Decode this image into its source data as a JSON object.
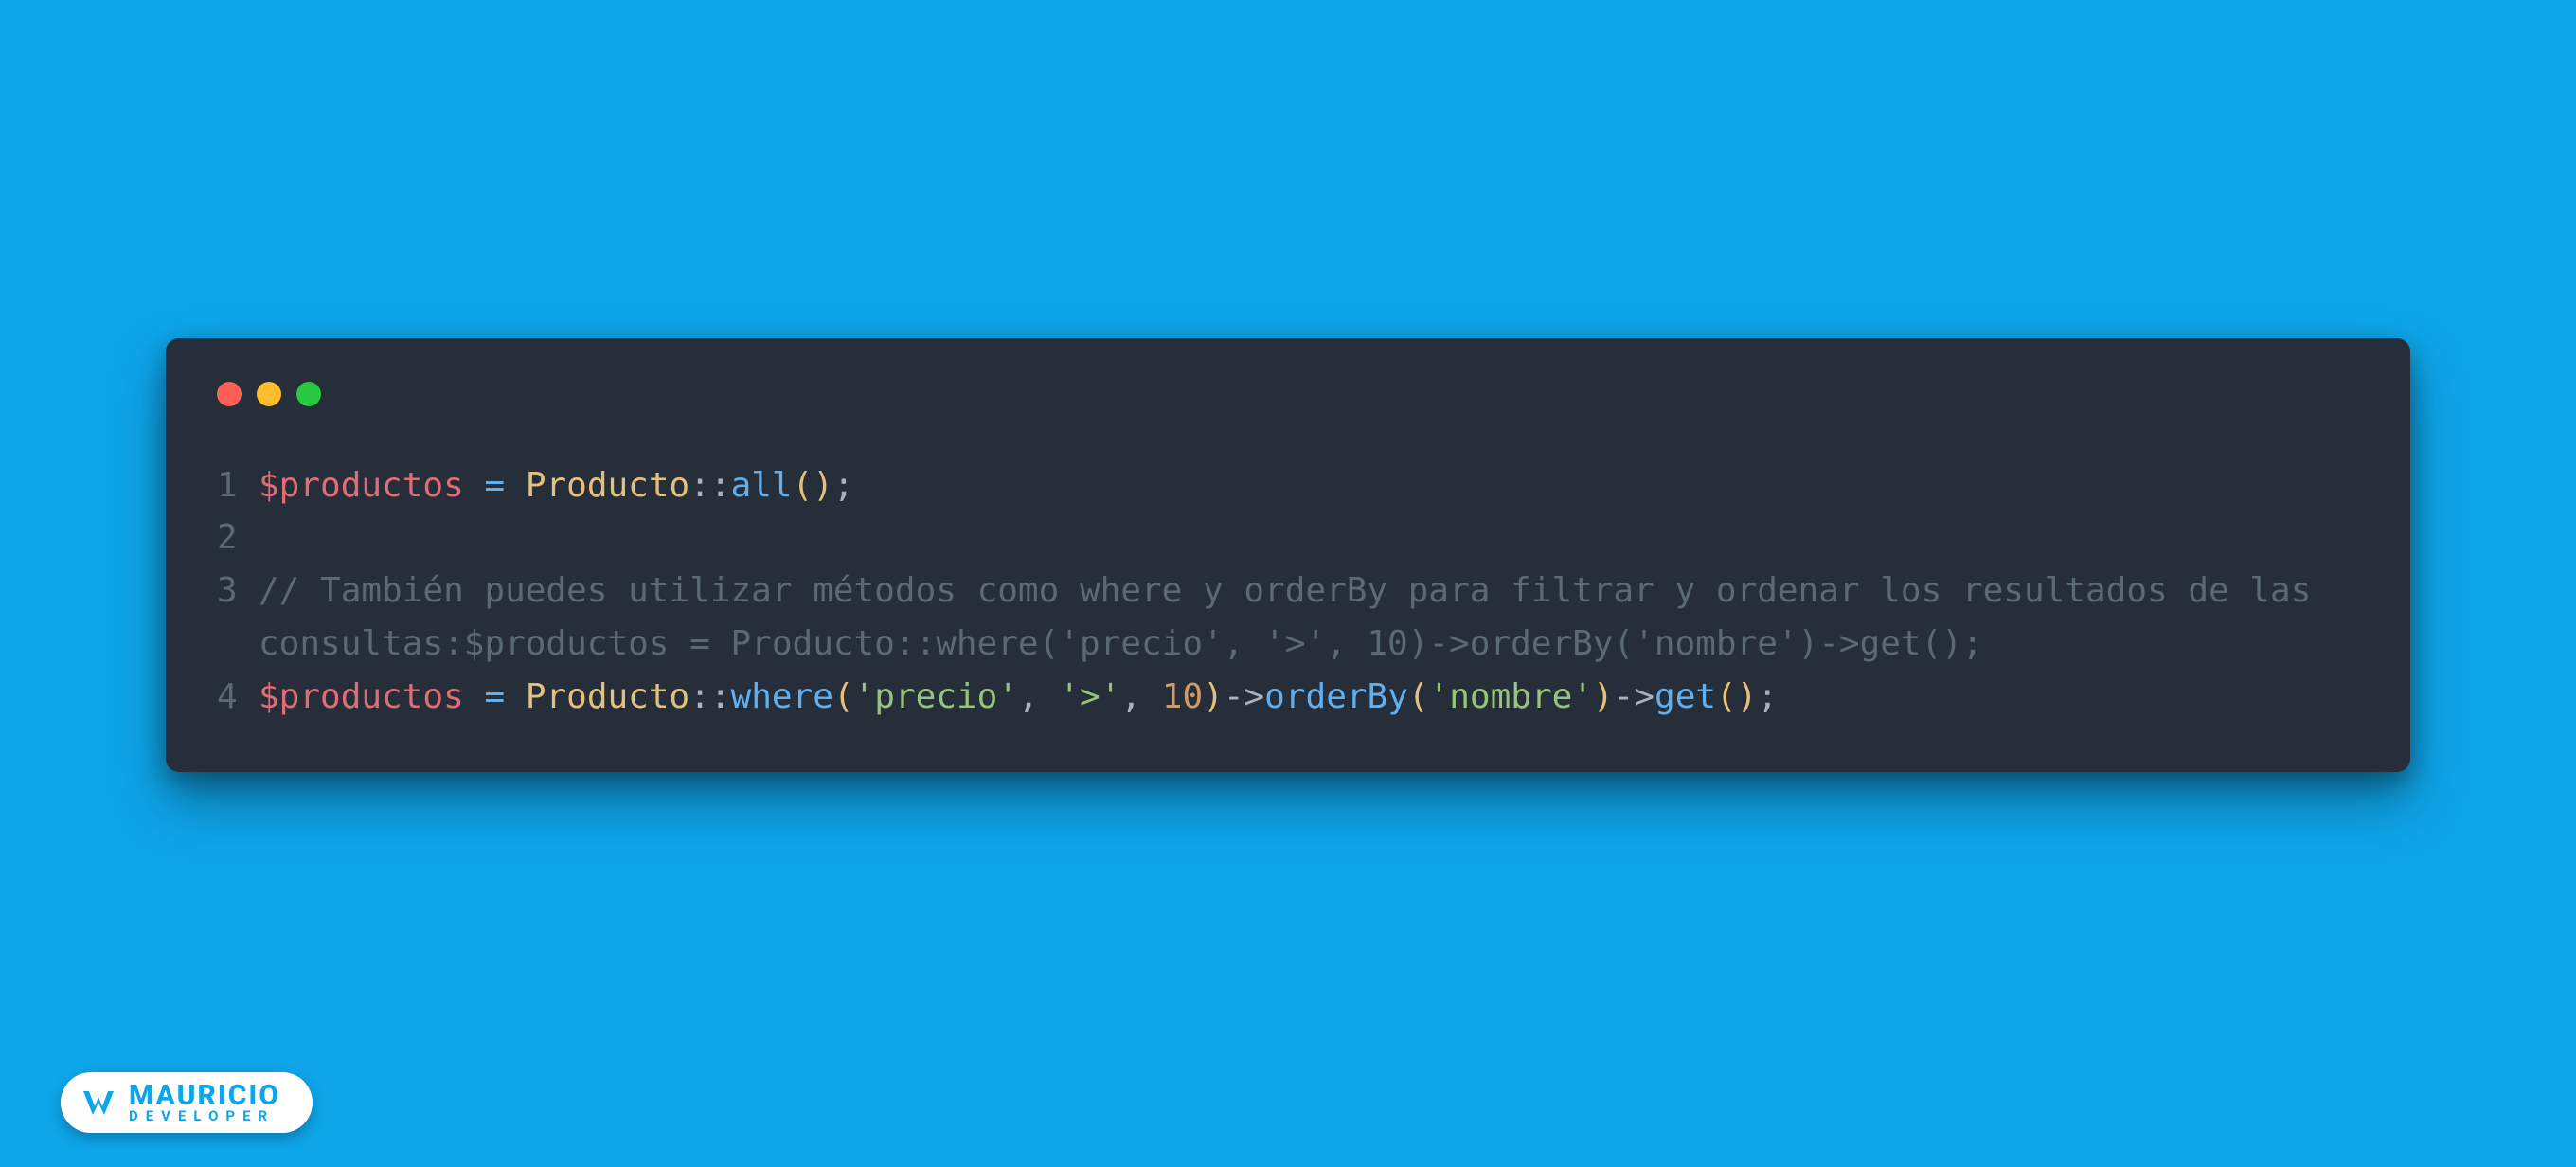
{
  "window": {
    "traffic_lights": [
      "red",
      "yellow",
      "green"
    ]
  },
  "code": {
    "lines": [
      {
        "n": "1",
        "tokens": [
          {
            "t": "$productos",
            "c": "tok-var"
          },
          {
            "t": " ",
            "c": ""
          },
          {
            "t": "=",
            "c": "tok-op"
          },
          {
            "t": " ",
            "c": ""
          },
          {
            "t": "Producto",
            "c": "tok-class"
          },
          {
            "t": "::",
            "c": "tok-scope"
          },
          {
            "t": "all",
            "c": "tok-func"
          },
          {
            "t": "()",
            "c": "tok-paren"
          },
          {
            "t": ";",
            "c": "tok-punct"
          }
        ]
      },
      {
        "n": "2",
        "tokens": []
      },
      {
        "n": "3",
        "tokens": [
          {
            "t": "// También puedes utilizar métodos como where y orderBy para filtrar y ordenar los resultados de las consultas:$productos = Producto::where('precio', '>', 10)->orderBy('nombre')->get();",
            "c": "tok-comment"
          }
        ]
      },
      {
        "n": "4",
        "tokens": [
          {
            "t": "$productos",
            "c": "tok-var"
          },
          {
            "t": " ",
            "c": ""
          },
          {
            "t": "=",
            "c": "tok-op"
          },
          {
            "t": " ",
            "c": ""
          },
          {
            "t": "Producto",
            "c": "tok-class"
          },
          {
            "t": "::",
            "c": "tok-scope"
          },
          {
            "t": "where",
            "c": "tok-func"
          },
          {
            "t": "(",
            "c": "tok-paren"
          },
          {
            "t": "'precio'",
            "c": "tok-string"
          },
          {
            "t": ", ",
            "c": "tok-punct"
          },
          {
            "t": "'>'",
            "c": "tok-string"
          },
          {
            "t": ", ",
            "c": "tok-punct"
          },
          {
            "t": "10",
            "c": "tok-number"
          },
          {
            "t": ")",
            "c": "tok-paren"
          },
          {
            "t": "->",
            "c": "tok-punct"
          },
          {
            "t": "orderBy",
            "c": "tok-func"
          },
          {
            "t": "(",
            "c": "tok-paren"
          },
          {
            "t": "'nombre'",
            "c": "tok-string"
          },
          {
            "t": ")",
            "c": "tok-paren"
          },
          {
            "t": "->",
            "c": "tok-punct"
          },
          {
            "t": "get",
            "c": "tok-func"
          },
          {
            "t": "()",
            "c": "tok-paren"
          },
          {
            "t": ";",
            "c": "tok-punct"
          }
        ]
      }
    ]
  },
  "badge": {
    "top": "MAURICIO",
    "bottom": "DEVELOPER",
    "icon": "logo-mark"
  },
  "colors": {
    "background": "#0ea5e9",
    "window_bg": "#252e39",
    "comment": "#5b6876",
    "variable": "#e06c75",
    "class": "#e5c07b",
    "function": "#61afef",
    "string": "#98c379",
    "number": "#d19a66"
  }
}
